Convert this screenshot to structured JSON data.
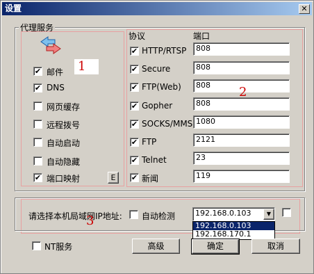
{
  "window": {
    "title": "设置",
    "close_glyph": "✕"
  },
  "proxy_group": {
    "legend": "代理服务",
    "left_items": [
      {
        "label": "邮件",
        "checked": true
      },
      {
        "label": "DNS",
        "checked": true
      },
      {
        "label": "网页缓存",
        "checked": false
      },
      {
        "label": "远程拨号",
        "checked": false
      },
      {
        "label": "自动启动",
        "checked": false
      },
      {
        "label": "自动隐藏",
        "checked": false
      },
      {
        "label": "端口映射",
        "checked": true
      }
    ],
    "port_map_button": "E",
    "protocol_header": "协议",
    "port_header": "端口",
    "protocols": [
      {
        "label": "HTTP/RTSP",
        "port": "808",
        "checked": true
      },
      {
        "label": "Secure",
        "port": "808",
        "checked": true
      },
      {
        "label": "FTP(Web)",
        "port": "808",
        "checked": true
      },
      {
        "label": "Gopher",
        "port": "808",
        "checked": true
      },
      {
        "label": "SOCKS/MMS",
        "port": "1080",
        "checked": true
      },
      {
        "label": "FTP",
        "port": "2121",
        "checked": true
      },
      {
        "label": "Telnet",
        "port": "23",
        "checked": true
      },
      {
        "label": "新闻",
        "port": "119",
        "checked": true
      }
    ]
  },
  "lan_ip": {
    "prompt": "请选择本机局域网IP地址:",
    "auto_detect_label": "自动检测",
    "auto_detect_checked": false,
    "selected_ip": "192.168.0.103",
    "options": [
      "192.168.0.103",
      "192.168.170.1"
    ],
    "extra_checked": false
  },
  "bottom": {
    "nt_service_label": "NT服务",
    "nt_service_checked": false,
    "advanced_label": "高级",
    "ok_label": "确定",
    "cancel_label": "取消"
  },
  "annotations": {
    "one": "1",
    "two": "2",
    "three": "3",
    "color": "#cc0000"
  },
  "icons": {
    "swap": "swap-arrows-icon",
    "check": "✔",
    "dropdown_arrow": "▼"
  }
}
